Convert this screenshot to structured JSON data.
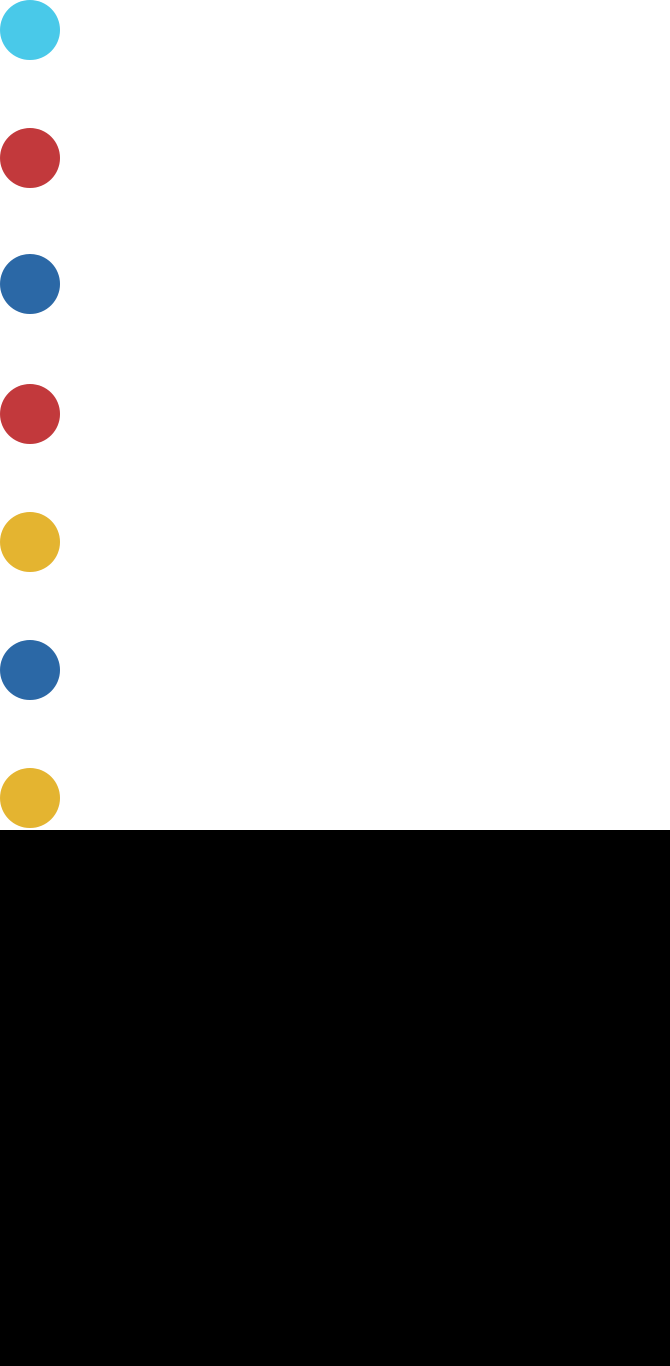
{
  "colors": {
    "panel_background": "#ffffff",
    "lower_background": "#000000"
  },
  "dots": [
    {
      "icon": "circle-icon",
      "color": "#49c9e9"
    },
    {
      "icon": "circle-icon",
      "color": "#c2393c"
    },
    {
      "icon": "circle-icon",
      "color": "#2b68a6"
    },
    {
      "icon": "circle-icon",
      "color": "#c2393c"
    },
    {
      "icon": "circle-icon",
      "color": "#e4b430"
    },
    {
      "icon": "circle-icon",
      "color": "#2b68a6"
    },
    {
      "icon": "circle-icon",
      "color": "#e4b430"
    }
  ]
}
